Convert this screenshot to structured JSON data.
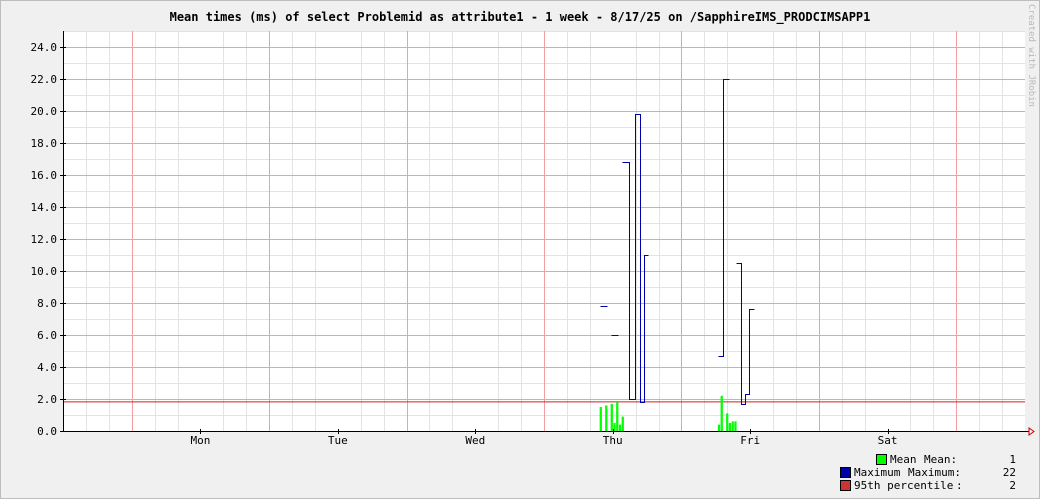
{
  "title": "Mean times (ms) of select Problemid as attribute1 - 1 week - 8/17/25 on /SapphireIMS_PRODCIMSAPP1",
  "credit": "Created with JRobin",
  "colors": {
    "background": "#f0f0f0",
    "plot_background": "#ffffff",
    "minor_grid": "#e3e3e3",
    "major_grid": "#f0a0a0",
    "axis": "#000000",
    "mean": "#00ff00",
    "maximum": "#0000aa",
    "percentile": "#cc2222",
    "arrow": "#cc0000"
  },
  "chart_data": {
    "type": "bar",
    "title": "Mean times (ms) of select Problemid as attribute1 - 1 week - 8/17/25 on /SapphireIMS_PRODCIMSAPP1",
    "xlabel": "",
    "ylabel": "",
    "x_ticks": [
      "Mon",
      "Tue",
      "Wed",
      "Thu",
      "Fri",
      "Sat"
    ],
    "x_tick_positions_days": [
      1,
      2,
      3,
      4,
      5,
      6
    ],
    "xlim_days": [
      0.0,
      7.0
    ],
    "ylim": [
      0,
      25
    ],
    "y_ticks": [
      "0.0",
      "2.0",
      "4.0",
      "6.0",
      "8.0",
      "10.0",
      "12.0",
      "14.0",
      "16.0",
      "18.0",
      "20.0",
      "22.0",
      "24.0"
    ],
    "grid": true,
    "series": [
      {
        "name": "Mean",
        "kind": "bars",
        "points": [
          {
            "t": 3.905,
            "y": 1.5
          },
          {
            "t": 3.925,
            "y": 0.0
          },
          {
            "t": 3.945,
            "y": 1.6
          },
          {
            "t": 3.965,
            "y": 0.0
          },
          {
            "t": 3.985,
            "y": 1.7
          },
          {
            "t": 4.005,
            "y": 0.5
          },
          {
            "t": 4.025,
            "y": 1.8
          },
          {
            "t": 4.045,
            "y": 0.4
          },
          {
            "t": 4.065,
            "y": 0.9
          },
          {
            "t": 4.765,
            "y": 0.4
          },
          {
            "t": 4.785,
            "y": 2.2
          },
          {
            "t": 4.805,
            "y": 0.0
          },
          {
            "t": 4.825,
            "y": 1.1
          },
          {
            "t": 4.845,
            "y": 0.5
          },
          {
            "t": 4.865,
            "y": 0.6
          },
          {
            "t": 4.885,
            "y": 0.6
          }
        ]
      },
      {
        "name": "Maximum",
        "kind": "step",
        "segments": [
          [
            {
              "t": 3.905,
              "y": 7.8
            },
            {
              "t": 3.955,
              "y": 7.8
            }
          ],
          [
            {
              "t": 3.99,
              "y": 6.0
            },
            {
              "t": 4.04,
              "y": 6.0
            }
          ],
          [
            {
              "t": 4.07,
              "y": 16.8
            },
            {
              "t": 4.12,
              "y": 16.8
            },
            {
              "t": 4.12,
              "y": 2.0
            },
            {
              "t": 4.16,
              "y": 2.0
            },
            {
              "t": 4.16,
              "y": 19.8
            },
            {
              "t": 4.2,
              "y": 19.8
            },
            {
              "t": 4.2,
              "y": 1.8
            },
            {
              "t": 4.23,
              "y": 1.8
            },
            {
              "t": 4.23,
              "y": 11.0
            },
            {
              "t": 4.26,
              "y": 11.0
            }
          ],
          [
            {
              "t": 4.765,
              "y": 4.7
            },
            {
              "t": 4.805,
              "y": 4.7
            },
            {
              "t": 4.805,
              "y": 22.0
            },
            {
              "t": 4.845,
              "y": 22.0
            }
          ],
          [
            {
              "t": 4.9,
              "y": 10.5
            },
            {
              "t": 4.93,
              "y": 10.5
            },
            {
              "t": 4.93,
              "y": 1.7
            },
            {
              "t": 4.96,
              "y": 1.7
            },
            {
              "t": 4.96,
              "y": 2.3
            },
            {
              "t": 4.99,
              "y": 2.3
            },
            {
              "t": 4.99,
              "y": 7.6
            },
            {
              "t": 5.03,
              "y": 7.6
            }
          ]
        ]
      },
      {
        "name": "95th percentile",
        "kind": "hline",
        "y": 1.85
      }
    ]
  },
  "legend": [
    {
      "name": "Mean",
      "stat": "Mean:",
      "value": "1",
      "color": "#00ff00"
    },
    {
      "name": "Maximum",
      "stat": "Maximum:",
      "value": "22",
      "color": "#0000aa"
    },
    {
      "name": "95th percentile",
      "stat": ":",
      "value": "2",
      "color": "#cc3333"
    }
  ]
}
